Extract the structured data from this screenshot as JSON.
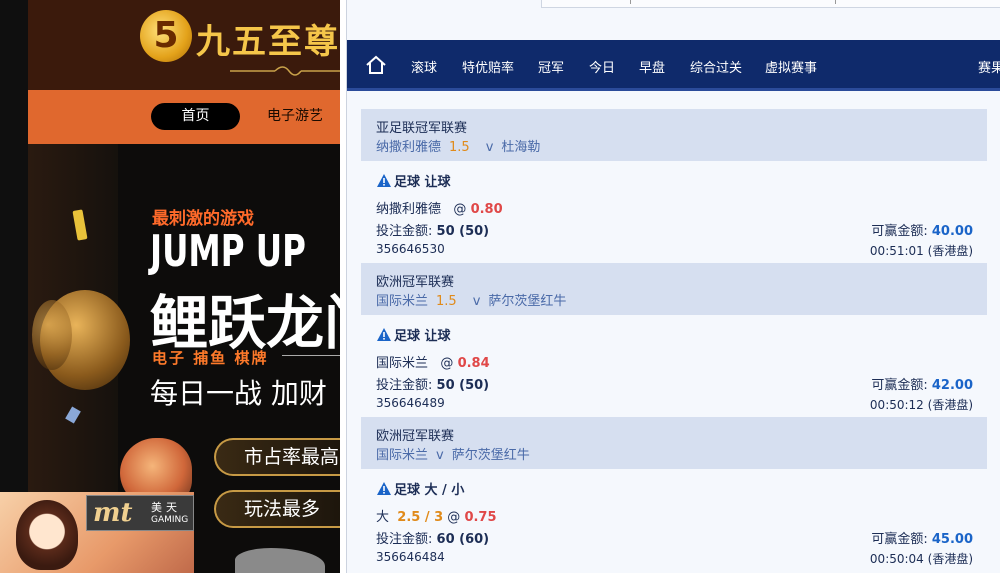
{
  "left_site": {
    "logo_mark": "5",
    "logo_text": "九五至尊",
    "nav": {
      "home": "首页",
      "item": "电子游艺"
    },
    "banner": {
      "tagline": "最刺激的游戏",
      "title_en": "JUMP UP",
      "title_cn": "鲤跃龙门",
      "categories": "电子  捕鱼  棋牌",
      "slogan": "每日一战  加财",
      "badge1": "市占率最高",
      "badge2": "玩法最多"
    },
    "mt_logo": {
      "mark": "mt",
      "cn": "美天",
      "en": "GAMING"
    }
  },
  "betting_panel": {
    "nav_tabs": [
      "滚球",
      "特优赔率",
      "冠军",
      "今日",
      "早盘",
      "综合过关",
      "虚拟赛事",
      "赛果"
    ],
    "bets": [
      {
        "league": "亚足联冠军联赛",
        "home": "纳撒利雅德",
        "handicap": "1.5",
        "vs": "v",
        "away": "杜海勒",
        "bet_type": "足球 让球",
        "pick_team": "纳撒利雅德",
        "pick_line": "",
        "at": "@",
        "odds": "0.80",
        "stake_label": "投注金额:",
        "stake": "50 (50)",
        "win_label": "可赢金额:",
        "win": "40.00",
        "ticket": "356646530",
        "time": "00:51:01 (香港盘)"
      },
      {
        "league": "欧洲冠军联赛",
        "home": "国际米兰",
        "handicap": "1.5",
        "vs": "v",
        "away": "萨尔茨堡红牛",
        "bet_type": "足球 让球",
        "pick_team": "国际米兰",
        "pick_line": "",
        "at": "@",
        "odds": "0.84",
        "stake_label": "投注金额:",
        "stake": "50 (50)",
        "win_label": "可赢金额:",
        "win": "42.00",
        "ticket": "356646489",
        "time": "00:50:12 (香港盘)"
      },
      {
        "league": "欧洲冠军联赛",
        "home": "国际米兰",
        "handicap": "",
        "vs": "v",
        "away": "萨尔茨堡红牛",
        "bet_type": "足球 大 / 小",
        "pick_team": "大",
        "pick_line": "2.5 / 3",
        "at": "@",
        "odds": "0.75",
        "stake_label": "投注金额:",
        "stake": "60 (60)",
        "win_label": "可赢金额:",
        "win": "45.00",
        "ticket": "356646484",
        "time": "00:50:04 (香港盘)"
      }
    ]
  }
}
